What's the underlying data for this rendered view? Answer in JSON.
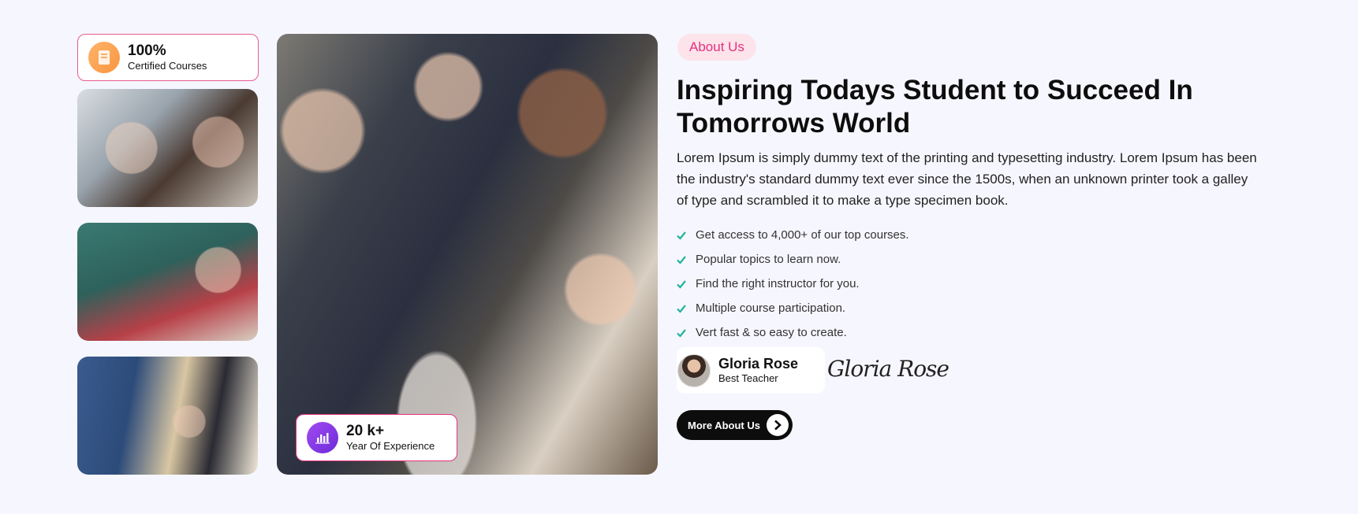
{
  "stats": {
    "certified": {
      "value": "100%",
      "label": "Certified Courses",
      "icon": "book-icon",
      "color": "#f9963f"
    },
    "experience": {
      "value": "20 k+",
      "label": "Year Of Experience",
      "icon": "chart-icon",
      "color": "#8a3ae6"
    }
  },
  "about": {
    "tag": "About Us",
    "headline": "Inspiring Todays Student to Succeed In Tomorrows World",
    "description": "Lorem Ipsum is simply dummy text of the printing and typesetting industry. Lorem Ipsum has been the industry's standard dummy text ever since the 1500s, when an unknown printer took a galley of type and scrambled it to make a type specimen book.",
    "features": [
      "Get access to 4,000+ of our top courses.",
      "Popular topics to learn now.",
      "Find the right instructor for you.",
      "Multiple course participation.",
      "Vert fast & so easy to create."
    ]
  },
  "author": {
    "name": "Gloria Rose",
    "role": "Best Teacher",
    "signature": "Gloria Rose"
  },
  "cta": {
    "label": "More About Us"
  },
  "colors": {
    "accent": "#e5317f",
    "check": "#1fb39a",
    "background": "#f6f6fe"
  }
}
